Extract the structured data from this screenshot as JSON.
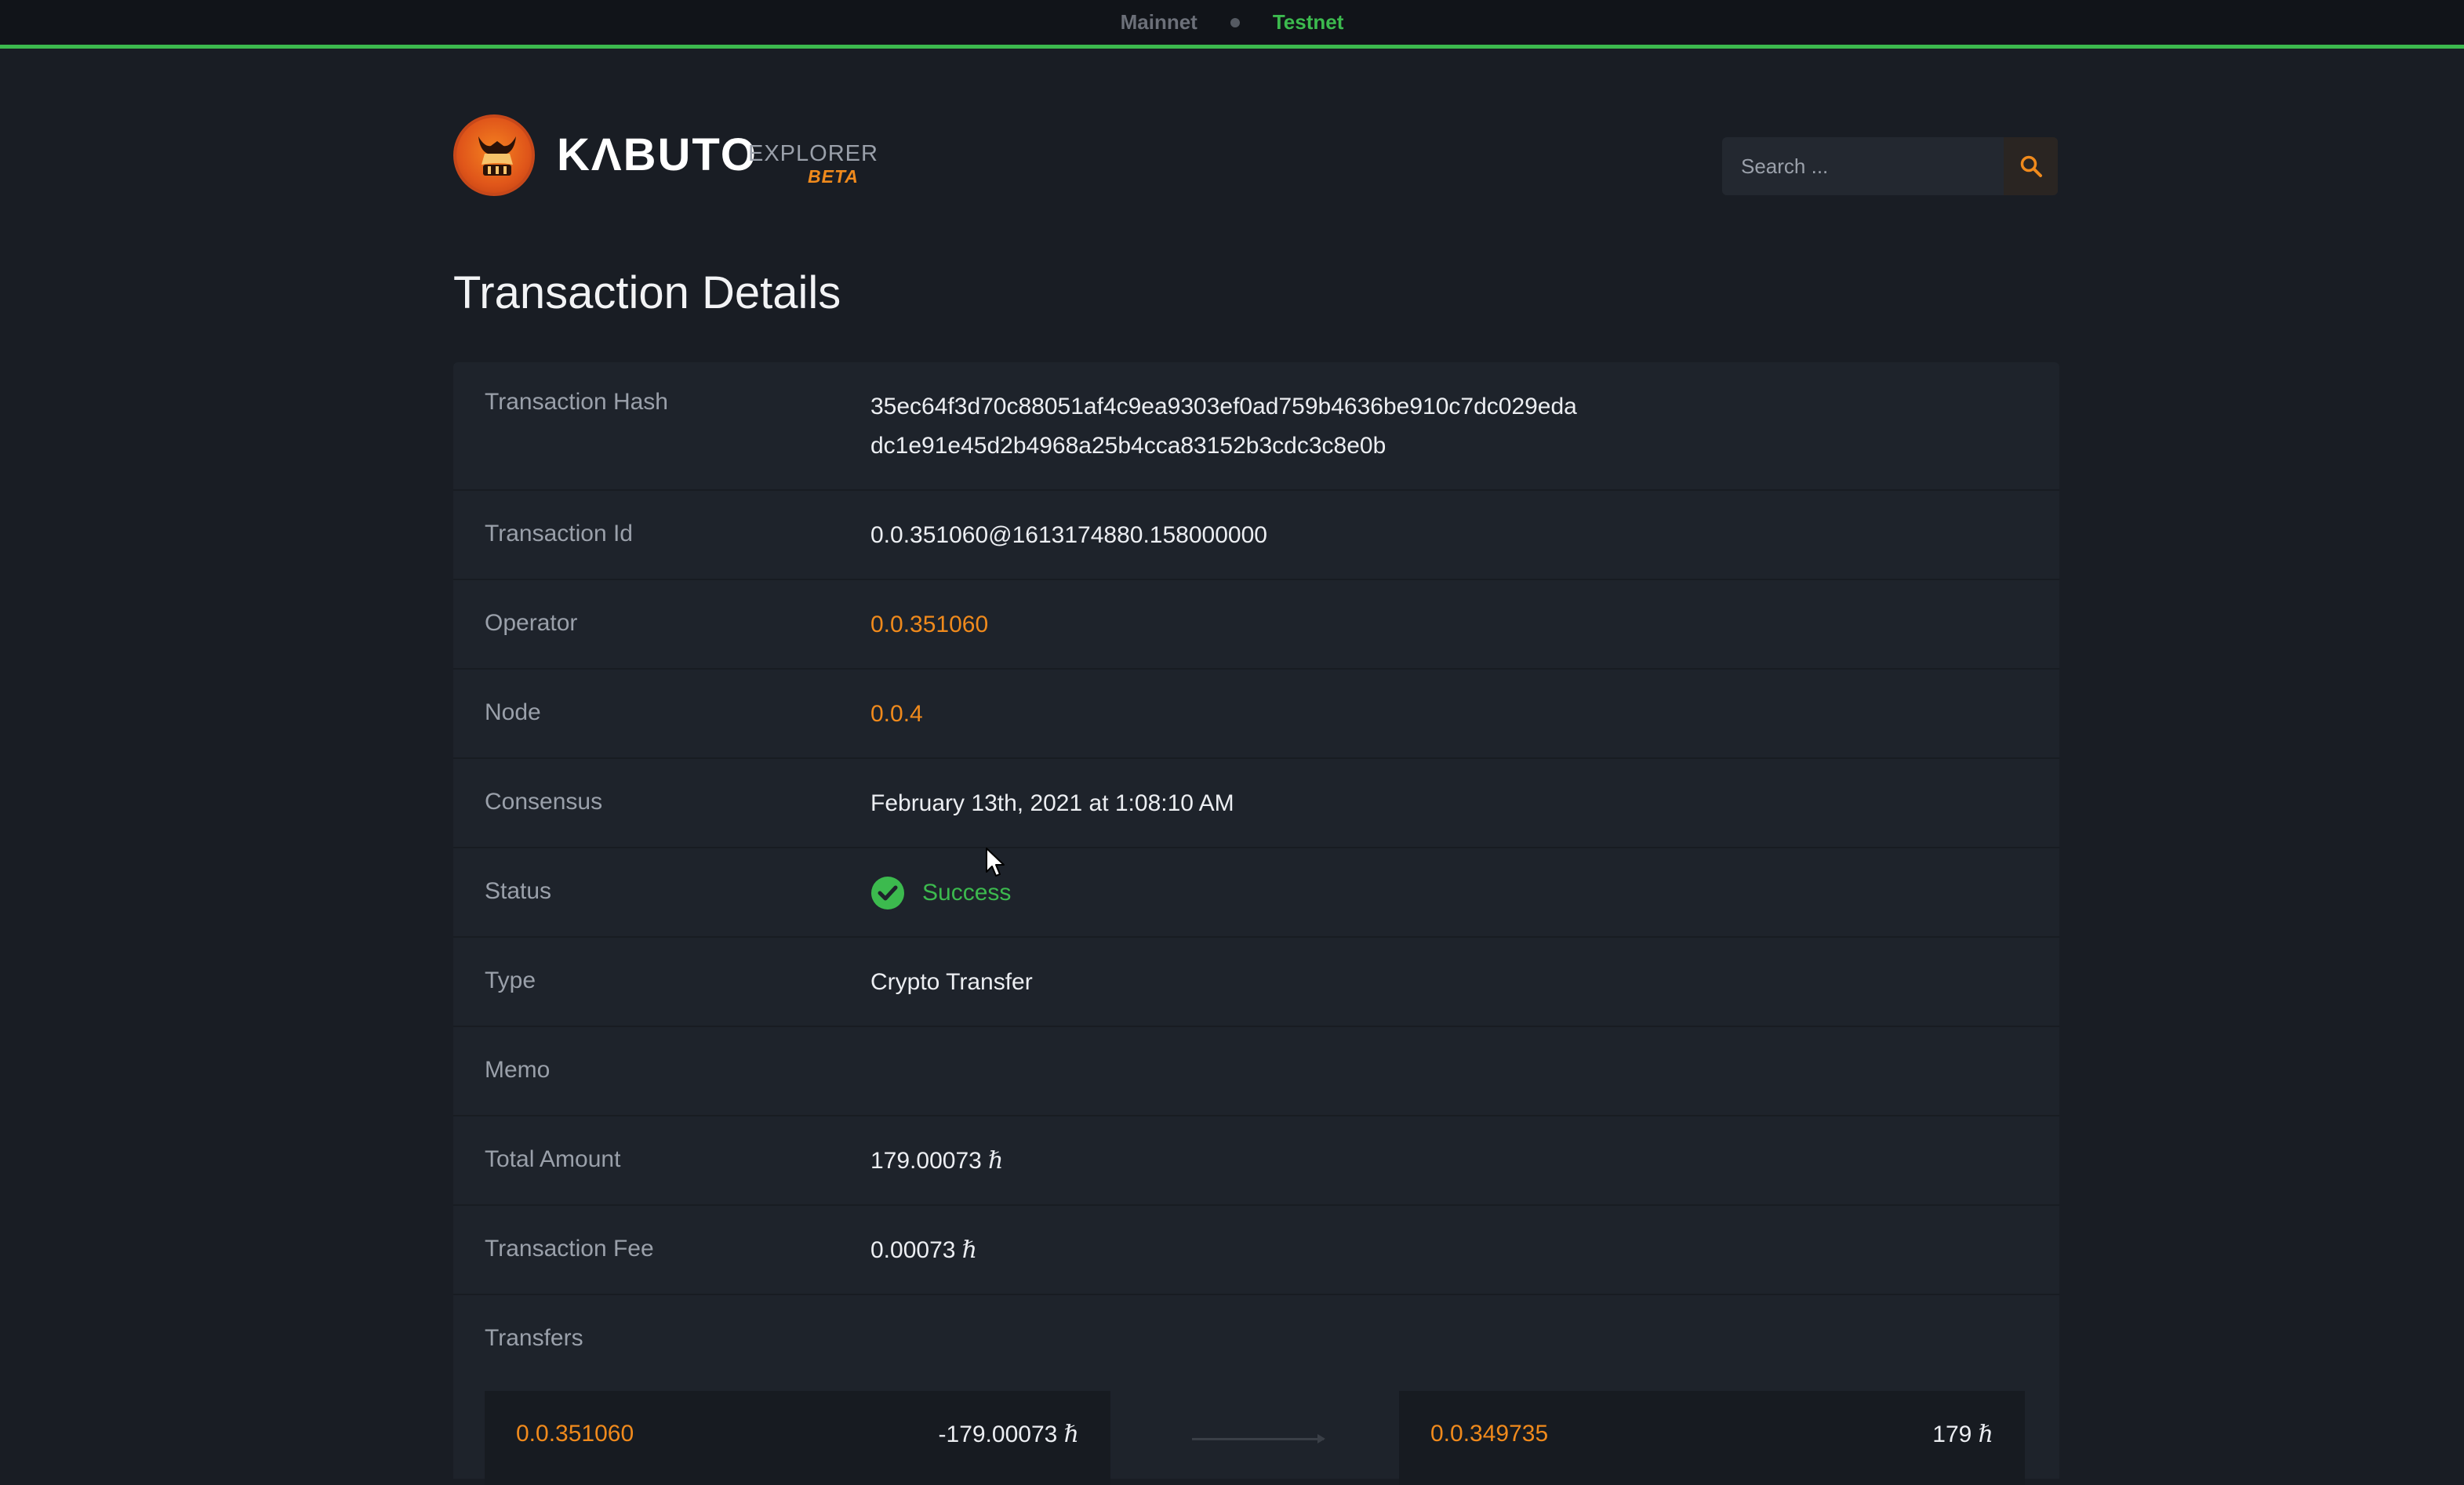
{
  "network": {
    "mainnet_label": "Mainnet",
    "testnet_label": "Testnet",
    "active": "Testnet"
  },
  "brand": {
    "name": "KΛBUTO",
    "explorer_label": "EXPLORER",
    "beta_label": "BETA",
    "accent_color": "#f08a1c"
  },
  "search": {
    "placeholder": "Search ...",
    "icon": "search-icon"
  },
  "page": {
    "title": "Transaction Details"
  },
  "details": {
    "hash_label": "Transaction Hash",
    "hash_line1": "35ec64f3d70c88051af4c9ea9303ef0ad759b4636be910c7dc029eda",
    "hash_line2": "dc1e91e45d2b4968a25b4cca83152b3cdc3c8e0b",
    "id_label": "Transaction Id",
    "id_value": "0.0.351060@1613174880.158000000",
    "operator_label": "Operator",
    "operator_value": "0.0.351060",
    "node_label": "Node",
    "node_value": "0.0.4",
    "consensus_label": "Consensus",
    "consensus_value": "February 13th, 2021 at 1:08:10 AM",
    "status_label": "Status",
    "status_value": "Success",
    "status_color": "#3cba4e",
    "type_label": "Type",
    "type_value": "Crypto Transfer",
    "memo_label": "Memo",
    "memo_value": "",
    "total_label": "Total Amount",
    "total_value": "179.00073",
    "fee_label": "Transaction Fee",
    "fee_value": "0.00073",
    "hbar_symbol": "ℏ",
    "transfers_label": "Transfers"
  },
  "transfers": {
    "from_account": "0.0.351060",
    "from_amount": "-179.00073",
    "to_account": "0.0.349735",
    "to_amount": "179"
  }
}
